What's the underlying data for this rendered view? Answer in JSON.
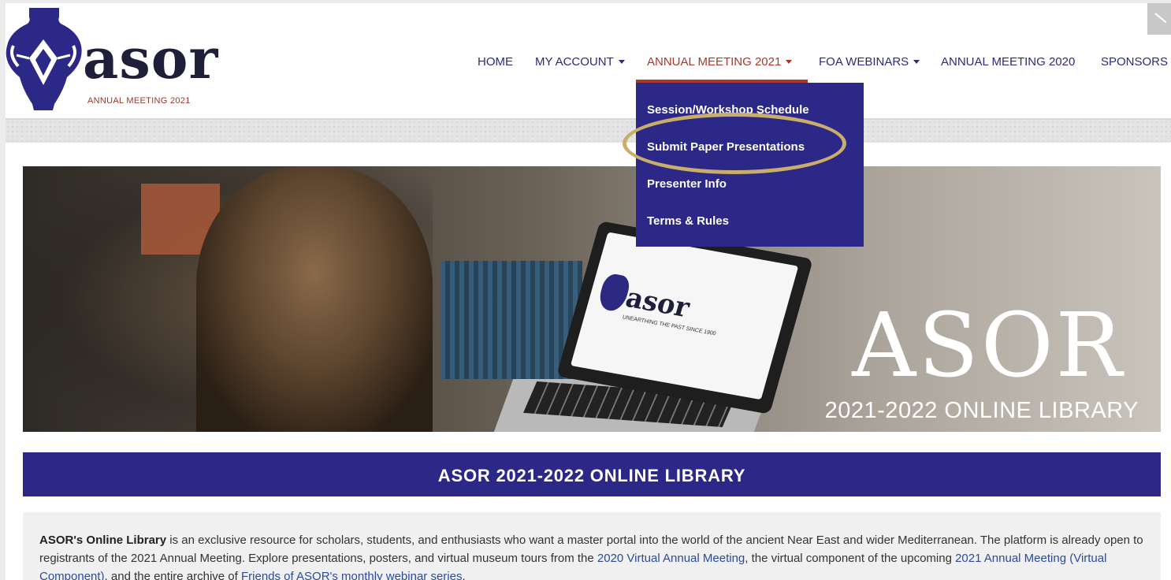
{
  "header": {
    "logo": {
      "word": "asor",
      "subtitle": "ANNUAL MEETING 2021"
    },
    "nav": [
      {
        "label": "HOME",
        "has_caret": false
      },
      {
        "label": "MY ACCOUNT",
        "has_caret": true
      },
      {
        "label": "ANNUAL MEETING 2021",
        "has_caret": true,
        "active": true
      },
      {
        "label": "FOA WEBINARS",
        "has_caret": true
      },
      {
        "label": "ANNUAL MEETING 2020",
        "has_caret": false
      },
      {
        "label": "SPONSORS",
        "has_caret": false
      }
    ]
  },
  "dropdown": {
    "items": [
      "Session/Workshop Schedule",
      "Submit Paper Presentations",
      "Presenter Info",
      "Terms & Rules"
    ],
    "highlighted_index": 1
  },
  "hero": {
    "title": "ASOR",
    "subtitle": "2021-2022 ONLINE LIBRARY",
    "laptop_logo": "asor",
    "laptop_tagline": "UNEARTHING THE PAST SINCE 1900"
  },
  "banner": {
    "title": "ASOR 2021-2022 ONLINE LIBRARY"
  },
  "intro": {
    "strong": "ASOR's Online Library",
    "text_1": " is an exclusive resource for scholars, students, and enthusiasts who want a master portal into the world of the ancient Near East and wider Mediterranean. The platform is already open to registrants of the 2021 Annual Meeting. Explore presentations, posters, and virtual museum tours from the ",
    "link_1": "2020 Virtual Annual Meeting",
    "text_2": ", the virtual component of the upcoming ",
    "link_2": "2021 Annual Meeting (Virtual Component)",
    "text_3": ", and the entire archive of ",
    "link_3": "Friends of ASOR's monthly webinar series",
    "text_4": "."
  },
  "colors": {
    "brand_navy": "#2b2887",
    "nav_text": "#2b2b7a",
    "active_red": "#a8382c",
    "highlight_gold": "#c9ad6a",
    "link_blue": "#2b4c9a"
  }
}
